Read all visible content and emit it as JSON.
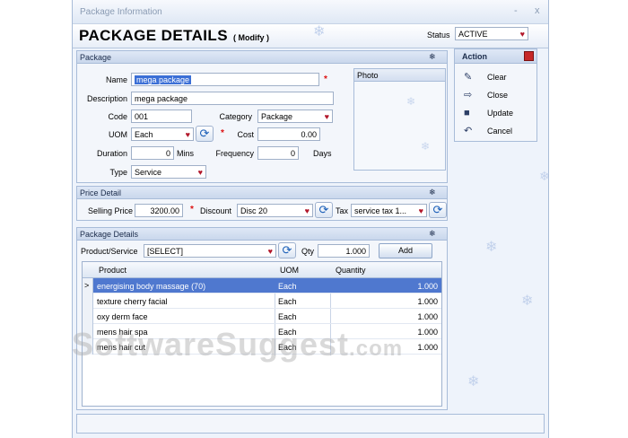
{
  "window": {
    "title": "Package Information",
    "minimize": "-",
    "close": "x"
  },
  "header": {
    "title": "PACKAGE DETAILS",
    "mode": "( Modify )",
    "status_label": "Status",
    "status_value": "ACTIVE"
  },
  "package": {
    "section_title": "Package",
    "name_label": "Name",
    "name_value": "mega package",
    "description_label": "Description",
    "description_value": "mega package",
    "code_label": "Code",
    "code_value": "001",
    "category_label": "Category",
    "category_value": "Package",
    "uom_label": "UOM",
    "uom_value": "Each",
    "cost_label": "Cost",
    "cost_value": "0.00",
    "duration_label": "Duration",
    "duration_value": "0",
    "duration_unit": "Mins",
    "frequency_label": "Frequency",
    "frequency_value": "0",
    "frequency_unit": "Days",
    "type_label": "Type",
    "type_value": "Service",
    "photo_label": "Photo",
    "required_mark": "*"
  },
  "action": {
    "title": "Action",
    "items": [
      {
        "label": "Clear",
        "icon": "broom-icon"
      },
      {
        "label": "Close",
        "icon": "close-door-icon"
      },
      {
        "label": "Update",
        "icon": "save-icon"
      },
      {
        "label": "Cancel",
        "icon": "undo-icon"
      }
    ]
  },
  "price": {
    "section_title": "Price Detail",
    "selling_price_label": "Selling Price",
    "selling_price_value": "3200.00",
    "discount_label": "Discount",
    "discount_value": "Disc 20",
    "tax_label": "Tax",
    "tax_value": "service tax 1..."
  },
  "package_details": {
    "section_title": "Package Details",
    "product_label": "Product/Service",
    "product_value": "[SELECT]",
    "qty_label": "Qty",
    "qty_value": "1.000",
    "add_label": "Add",
    "columns": [
      "Product",
      "UOM",
      "Quantity"
    ],
    "rows": [
      {
        "product": "energising body massage (70)",
        "uom": "Each",
        "quantity": "1.000"
      },
      {
        "product": "texture cherry facial",
        "uom": "Each",
        "quantity": "1.000"
      },
      {
        "product": "oxy derm face",
        "uom": "Each",
        "quantity": "1.000"
      },
      {
        "product": "mens hair spa",
        "uom": "Each",
        "quantity": "1.000"
      },
      {
        "product": "mens hair cut",
        "uom": "Each",
        "quantity": "1.000"
      }
    ],
    "row_indicator": ">"
  },
  "watermark": {
    "text": "SoftwareSuggest",
    "suffix": ".com"
  },
  "colors": {
    "accent": "#3b6fd6",
    "selected_row": "#4f78cf",
    "required": "#dd1111",
    "panel_header": "#c9d7ec"
  }
}
